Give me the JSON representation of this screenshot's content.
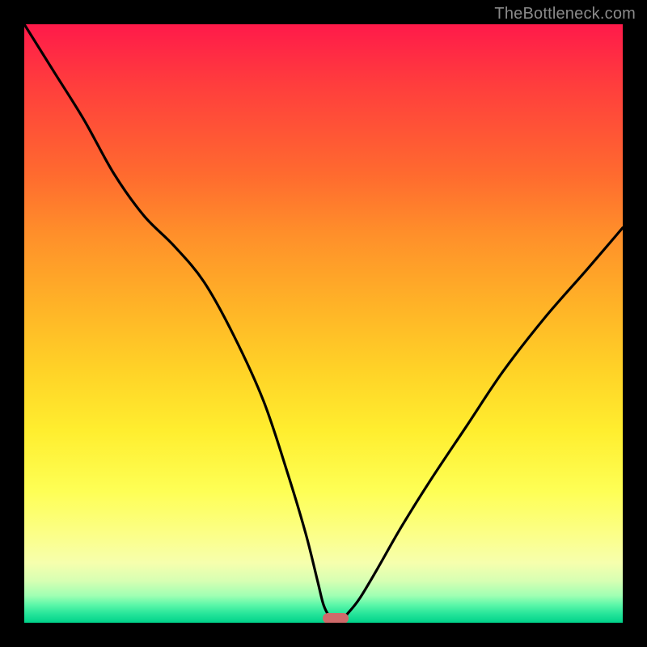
{
  "watermark": "TheBottleneck.com",
  "marker": {
    "x_pct": 52,
    "y_pct": 99
  },
  "chart_data": {
    "type": "line",
    "title": "",
    "xlabel": "",
    "ylabel": "",
    "xlim": [
      0,
      100
    ],
    "ylim": [
      0,
      100
    ],
    "series": [
      {
        "name": "bottleneck-curve",
        "x": [
          0,
          5,
          10,
          15,
          20,
          25,
          30,
          35,
          40,
          44,
          47,
          49,
          50,
          51,
          52,
          53,
          54,
          56,
          59,
          63,
          68,
          74,
          80,
          87,
          94,
          100
        ],
        "y": [
          100,
          92,
          84,
          75,
          68,
          63,
          57,
          48,
          37,
          25,
          15,
          7,
          3,
          1,
          0,
          0.5,
          1.5,
          4,
          9,
          16,
          24,
          33,
          42,
          51,
          59,
          66
        ]
      }
    ],
    "annotations": [
      {
        "type": "marker",
        "x": 52,
        "y": 0.5,
        "label": "optimal-point"
      }
    ],
    "background_gradient": {
      "stops": [
        {
          "pct": 0,
          "color": "#ff1a4a"
        },
        {
          "pct": 50,
          "color": "#ffd327"
        },
        {
          "pct": 85,
          "color": "#fcff86"
        },
        {
          "pct": 100,
          "color": "#00d28a"
        }
      ]
    }
  }
}
